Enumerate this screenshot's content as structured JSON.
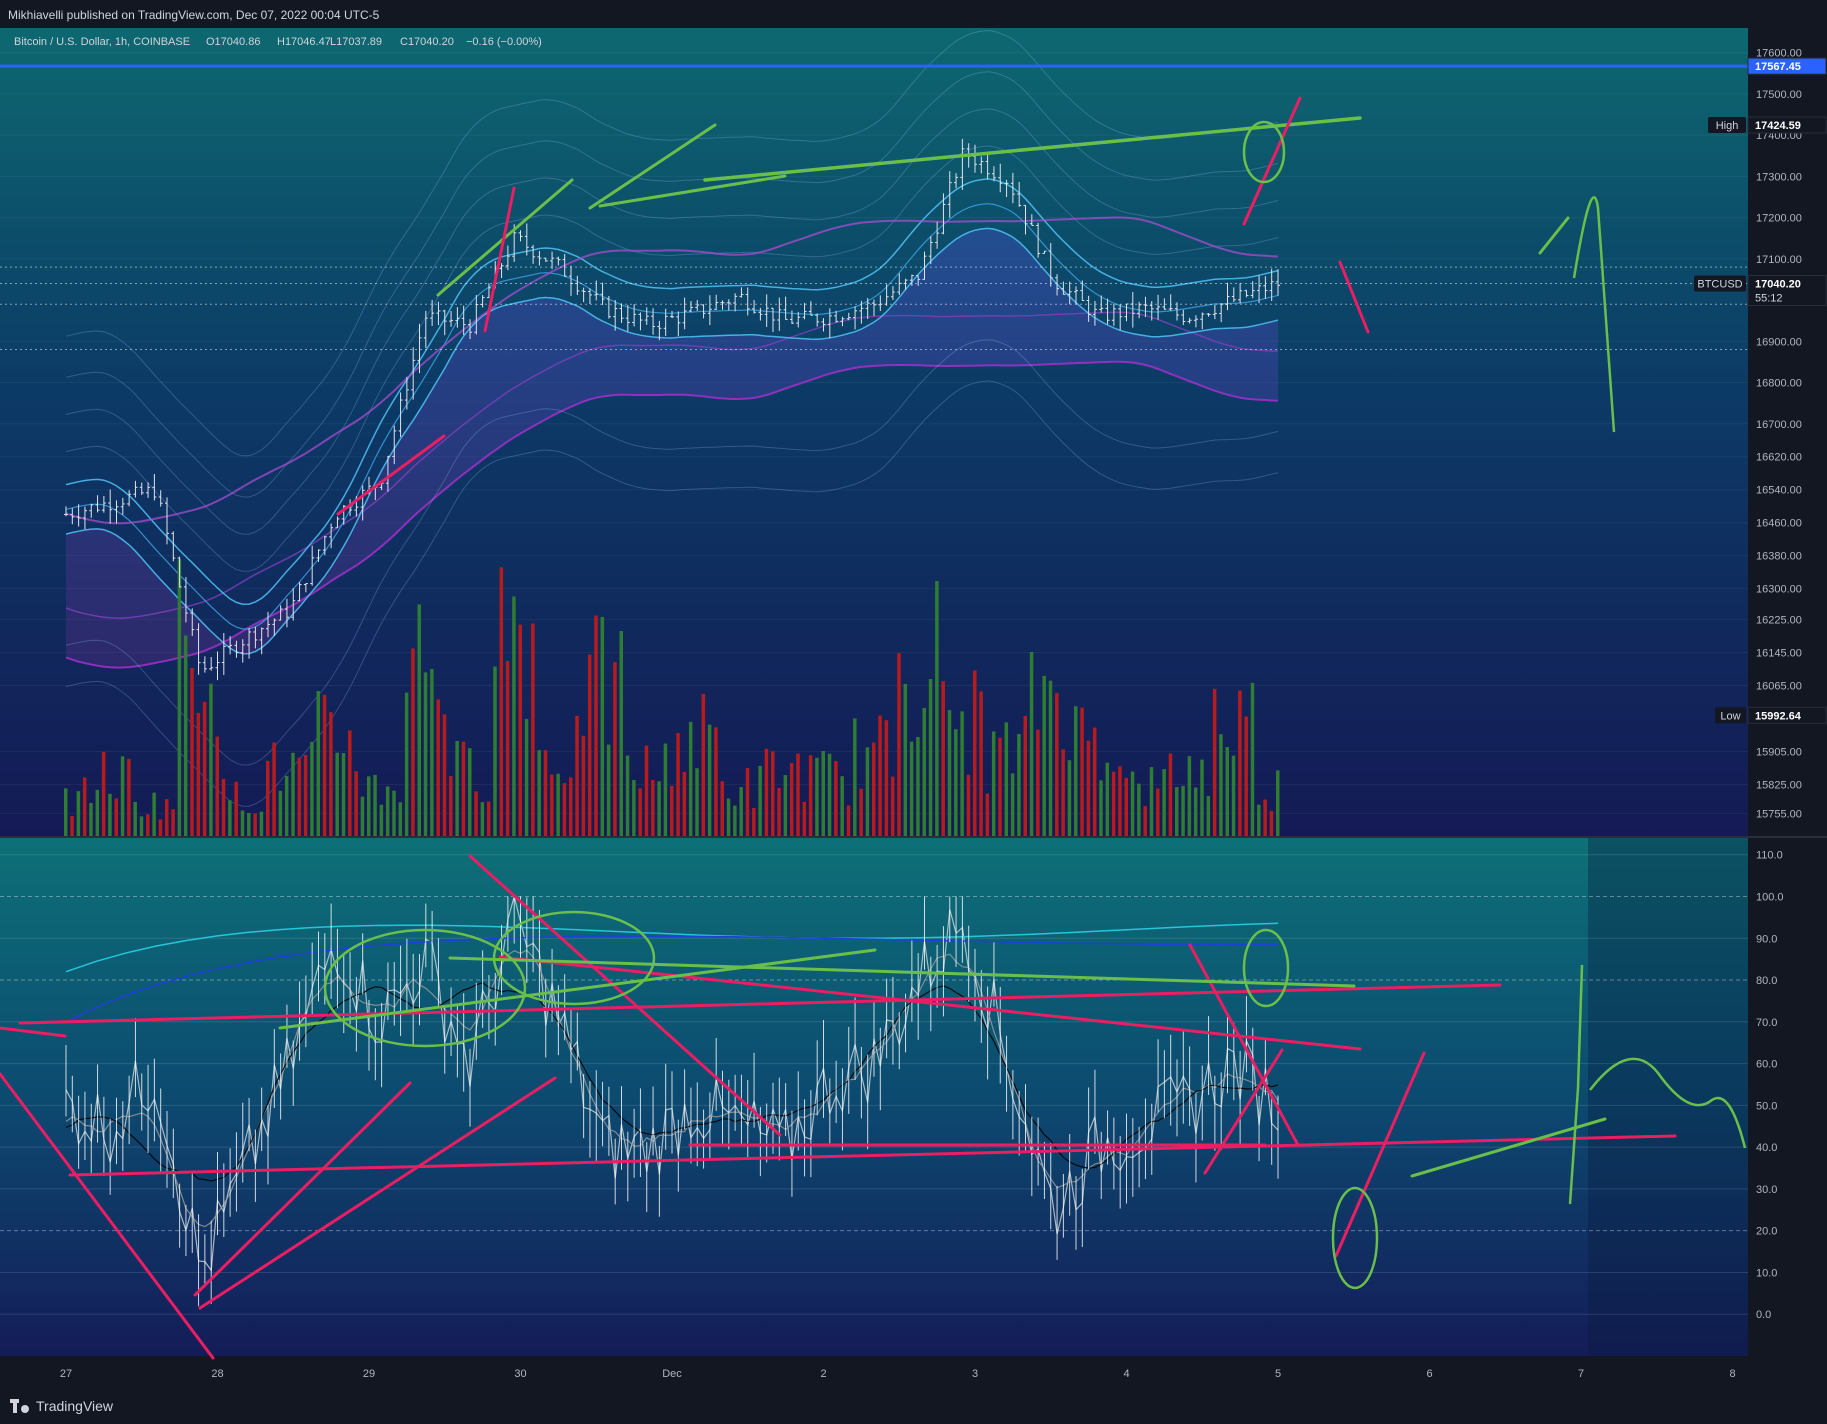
{
  "publisher": "Mikhiavelli published on TradingView.com, Dec 07, 2022 00:04 UTC-5",
  "legend": {
    "symbol": "Bitcoin / U.S. Dollar, 1h, COINBASE",
    "open": "O17040.86",
    "high": "H17046.47",
    "low": "L17037.89",
    "close": "C17040.20",
    "change": "−0.16 (−0.00%)"
  },
  "branding": "TradingView",
  "colors": {
    "accent_blue": "#2962ff",
    "candle": "#e0e3eb",
    "vol_up": "#2e7d32",
    "vol_down": "#b71c1c",
    "drawing_pink": "#e91e63",
    "drawing_green": "#6abf4b"
  },
  "chart_data": [
    {
      "type": "candlestick",
      "pane": "price",
      "timeframe": "1h",
      "ylim": [
        15700,
        17660
      ],
      "y_ticks": [
        "17600.00",
        "17500.00",
        "17400.00",
        "17300.00",
        "17200.00",
        "17100.00",
        "16900.00",
        "16800.00",
        "16700.00",
        "16620.00",
        "16540.00",
        "16460.00",
        "16380.00",
        "16300.00",
        "16225.00",
        "16145.00",
        "16065.00",
        "15905.00",
        "15825.00",
        "15755.00"
      ],
      "x_ticks": [
        "27",
        "28",
        "29",
        "30",
        "Dec",
        "2",
        "3",
        "4",
        "5",
        "6",
        "7",
        "8"
      ],
      "price_labels": [
        {
          "label": "",
          "value": "17567.45",
          "color": "#2962ff"
        },
        {
          "label": "High",
          "value": "17424.59",
          "color": "#131722"
        },
        {
          "label": "BTCUSD",
          "value": "17040.20",
          "sub": "55:12",
          "color": "#131722"
        },
        {
          "label": "Low",
          "value": "15992.64",
          "color": "#131722"
        }
      ],
      "horizontal_level": 17567.45,
      "x": [
        "Nov 27 00:00",
        "Nov 27 12:00",
        "Nov 27 18:00",
        "Nov 28 00:00",
        "Nov 28 12:00",
        "Nov 29 00:00",
        "Nov 29 12:00",
        "Nov 29 22:00",
        "Nov 30 00:00",
        "Nov 30 12:00",
        "Nov 30 18:00",
        "Dec 1 00:00",
        "Dec 1 12:00",
        "Dec 2 00:00",
        "Dec 2 12:00",
        "Dec 3 00:00",
        "Dec 3 12:00",
        "Dec 4 00:00",
        "Dec 4 12:00",
        "Dec 4 20:00",
        "Dec 5 00:00",
        "Dec 5 06:00",
        "Dec 5 12:00",
        "Dec 5 18:00",
        "Dec 6 00:00",
        "Dec 6 12:00",
        "Dec 6 20:00",
        "Dec 7 00:00"
      ],
      "close": [
        16480,
        16510,
        16540,
        16100,
        16180,
        16250,
        16480,
        16560,
        16960,
        16940,
        17150,
        17080,
        16980,
        16940,
        16970,
        17010,
        16950,
        16960,
        16990,
        17060,
        17360,
        17290,
        17050,
        16960,
        16980,
        16960,
        17000,
        17040
      ]
    },
    {
      "type": "bar",
      "pane": "volume",
      "series": [
        {
          "name": "Volume",
          "values": [
            12,
            18,
            10,
            60,
            12,
            20,
            30,
            15,
            55,
            20,
            65,
            25,
            45,
            20,
            30,
            15,
            20,
            18,
            25,
            55,
            35,
            25,
            45,
            30,
            15,
            20,
            35,
            15
          ]
        }
      ]
    },
    {
      "type": "line",
      "pane": "oscillator",
      "ylim": [
        -10,
        114
      ],
      "y_ticks": [
        "110.0",
        "100.0",
        "90.0",
        "80.0",
        "70.0",
        "60.0",
        "50.0",
        "40.0",
        "30.0",
        "20.0",
        "10.0",
        "0.0"
      ],
      "series": [
        {
          "values": [
            50,
            45,
            58,
            10,
            35,
            60,
            90,
            70,
            85,
            60,
            95,
            70,
            40,
            40,
            50,
            45,
            40,
            55,
            60,
            80,
            95,
            60,
            25,
            40,
            45,
            50,
            60,
            50
          ]
        }
      ]
    }
  ]
}
